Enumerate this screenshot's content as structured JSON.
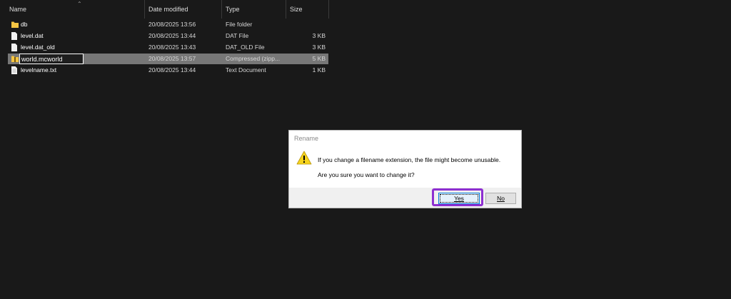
{
  "columns": {
    "name": "Name",
    "date": "Date modified",
    "type": "Type",
    "size": "Size"
  },
  "files": [
    {
      "name": "db",
      "date": "20/08/2025 13:56",
      "type": "File folder",
      "size": "",
      "icon": "folder-icon"
    },
    {
      "name": "level.dat",
      "date": "20/08/2025 13:44",
      "type": "DAT File",
      "size": "3 KB",
      "icon": "file-icon"
    },
    {
      "name": "level.dat_old",
      "date": "20/08/2025 13:43",
      "type": "DAT_OLD File",
      "size": "3 KB",
      "icon": "file-icon"
    },
    {
      "name": "world.mcworld",
      "date": "20/08/2025 13:57",
      "type": "Compressed (zipp...",
      "size": "5 KB",
      "icon": "zip-folder-icon",
      "renaming": true
    },
    {
      "name": "levelname.txt",
      "date": "20/08/2025 13:44",
      "type": "Text Document",
      "size": "1 KB",
      "icon": "text-file-icon"
    }
  ],
  "dialog": {
    "title": "Rename",
    "message": "If you change a filename extension, the file might become unusable.",
    "question": "Are you sure you want to change it?",
    "yes_label": "Yes",
    "no_label": "No",
    "icon": "warning-icon"
  },
  "colors": {
    "background": "#191919",
    "selected_row": "#777777",
    "highlight": "#8e2fd1",
    "button_focus": "#0078d7"
  }
}
